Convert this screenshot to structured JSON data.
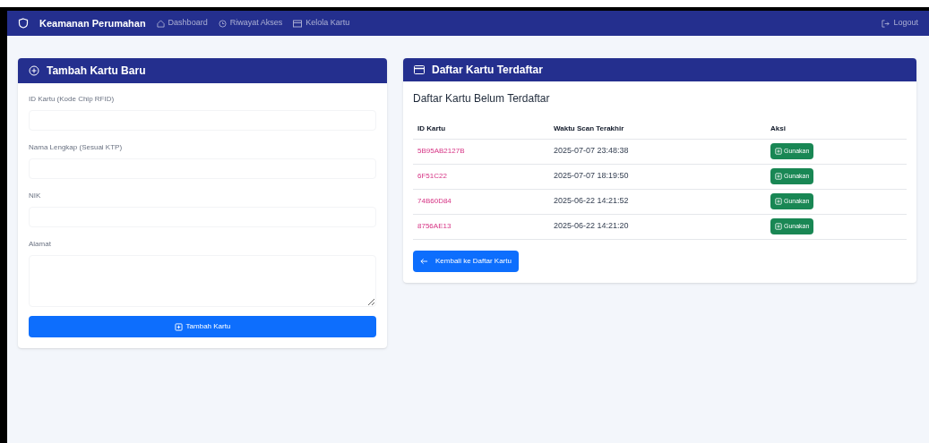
{
  "navbar": {
    "brand": "Keamanan Perumahan",
    "links": [
      {
        "label": "Dashboard",
        "selected": false
      },
      {
        "label": "Riwayat Akses",
        "selected": false
      },
      {
        "label": "Kelola Kartu",
        "selected": false
      }
    ],
    "logout": "Logout"
  },
  "add_card": {
    "title": "Tambah Kartu Baru",
    "fields": [
      {
        "label": "ID Kartu (Kode Chip RFID)",
        "kind": "input"
      },
      {
        "label": "Nama Lengkap (Sesuai KTP)",
        "kind": "input"
      },
      {
        "label": "NIK",
        "kind": "input"
      },
      {
        "label": "Alamat",
        "kind": "textarea"
      }
    ],
    "submit": "Tambah Kartu"
  },
  "card_list": {
    "title": "Daftar Kartu Terdaftar",
    "subtitle": "Daftar Kartu Belum Terdaftar",
    "columns": [
      "ID Kartu",
      "Waktu Scan Terakhir",
      "Aksi"
    ],
    "rows": [
      {
        "id": "5B95AB2127B",
        "time": "2025-07-07 23:48:38",
        "action": "Gunakan"
      },
      {
        "id": "6F51C22",
        "time": "2025-07-07 18:19:50",
        "action": "Gunakan"
      },
      {
        "id": "74B60D84",
        "time": "2025-06-22 14:21:52",
        "action": "Gunakan"
      },
      {
        "id": "8756AE13",
        "time": "2025-06-22 14:21:20",
        "action": "Gunakan"
      }
    ],
    "back": "Kembali ke Daftar Kartu"
  }
}
